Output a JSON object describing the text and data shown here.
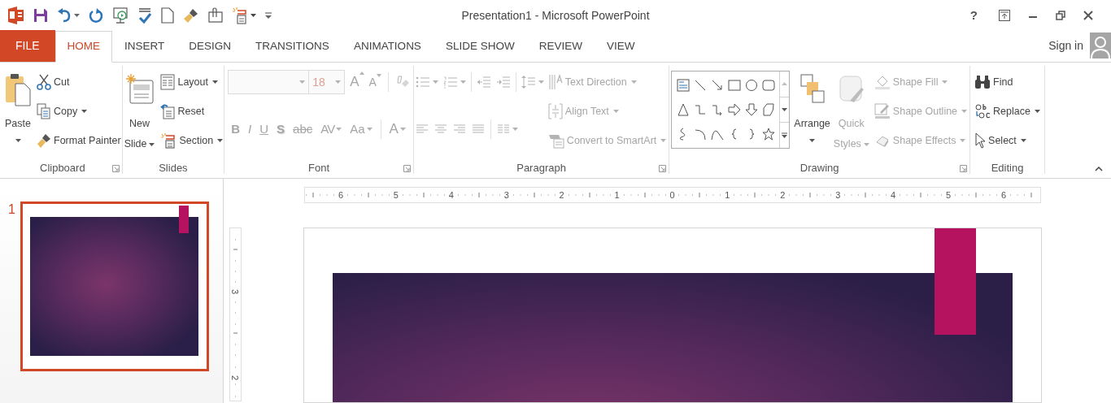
{
  "window": {
    "title": "Presentation1 - Microsoft PowerPoint",
    "help": "?"
  },
  "tabs": [
    {
      "label": "FILE",
      "kind": "file",
      "selected": false
    },
    {
      "label": "HOME",
      "kind": "tab",
      "selected": true
    },
    {
      "label": "INSERT",
      "kind": "tab",
      "selected": false
    },
    {
      "label": "DESIGN",
      "kind": "tab",
      "selected": false
    },
    {
      "label": "TRANSITIONS",
      "kind": "tab",
      "selected": false
    },
    {
      "label": "ANIMATIONS",
      "kind": "tab",
      "selected": false
    },
    {
      "label": "SLIDE SHOW",
      "kind": "tab",
      "selected": false
    },
    {
      "label": "REVIEW",
      "kind": "tab",
      "selected": false
    },
    {
      "label": "VIEW",
      "kind": "tab",
      "selected": false
    }
  ],
  "account": {
    "label": "Sign in"
  },
  "ribbon": {
    "groups": [
      {
        "kind": "clipboard",
        "label": "Clipboard",
        "launcher": true,
        "large": [
          {
            "lines": [
              "Paste"
            ],
            "dropdown": true,
            "disabled": false
          }
        ],
        "items": [
          {
            "label": "Cut",
            "dropdown": false,
            "disabled": false
          },
          {
            "label": "Copy",
            "dropdown": true,
            "disabled": false
          },
          {
            "label": "Format Painter",
            "dropdown": false,
            "disabled": false
          }
        ]
      },
      {
        "kind": "slides",
        "label": "Slides",
        "launcher": false,
        "large": [
          {
            "lines": [
              "New",
              "Slide"
            ],
            "dropdown": true,
            "disabled": false
          }
        ],
        "items": [
          {
            "label": "Layout",
            "dropdown": true,
            "disabled": false
          },
          {
            "label": "Reset",
            "dropdown": false,
            "disabled": false
          },
          {
            "label": "Section",
            "dropdown": true,
            "disabled": false
          }
        ]
      },
      {
        "kind": "font",
        "label": "Font",
        "launcher": true,
        "font_name": {
          "disabled": true
        },
        "font_size": {
          "value": "18",
          "disabled": true
        },
        "grow": {
          "label": "A",
          "disabled": true
        },
        "shrink": {
          "label": "A",
          "disabled": true
        },
        "buttons": [
          {
            "label": "B",
            "dropdown": false,
            "disabled": true
          },
          {
            "label": "I",
            "dropdown": false,
            "disabled": true
          },
          {
            "label": "U",
            "dropdown": false,
            "disabled": true
          },
          {
            "label": "S",
            "dropdown": false,
            "disabled": true
          },
          {
            "label": "abc",
            "dropdown": false,
            "disabled": true
          },
          {
            "label": "AV",
            "dropdown": true,
            "disabled": true
          },
          {
            "label": "Aa",
            "dropdown": true,
            "disabled": true
          },
          {
            "label": "A",
            "dropdown": true,
            "disabled": true
          }
        ]
      },
      {
        "kind": "paragraph",
        "label": "Paragraph",
        "launcher": true,
        "tools_disabled": true,
        "items": [
          {
            "label": "Text Direction",
            "dropdown": true,
            "disabled": true
          },
          {
            "label": "Align Text",
            "dropdown": true,
            "disabled": true
          },
          {
            "label": "Convert to SmartArt",
            "dropdown": true,
            "disabled": true
          }
        ]
      },
      {
        "kind": "drawing",
        "label": "Drawing",
        "launcher": true,
        "large": [
          {
            "lines": [
              "Arrange"
            ],
            "dropdown": true,
            "disabled": false
          },
          {
            "lines": [
              "Quick",
              "Styles"
            ],
            "dropdown": true,
            "disabled": true
          }
        ],
        "items": [
          {
            "label": "Shape Fill",
            "dropdown": true,
            "disabled": true
          },
          {
            "label": "Shape Outline",
            "dropdown": true,
            "disabled": true
          },
          {
            "label": "Shape Effects",
            "dropdown": true,
            "disabled": true
          }
        ]
      },
      {
        "kind": "editing",
        "label": "Editing",
        "launcher": false,
        "items": [
          {
            "label": "Find",
            "dropdown": false,
            "disabled": false
          },
          {
            "label": "Replace",
            "dropdown": true,
            "disabled": false
          },
          {
            "label": "Select",
            "dropdown": true,
            "disabled": false
          }
        ]
      }
    ]
  },
  "slides": [
    {
      "number": "1",
      "selected": true
    }
  ],
  "ruler": {
    "horizontal": [
      "6",
      "5",
      "4",
      "3",
      "2",
      "1",
      "0",
      "1",
      "2",
      "3",
      "4",
      "5",
      "6"
    ],
    "vertical": [
      "3",
      "2"
    ]
  }
}
